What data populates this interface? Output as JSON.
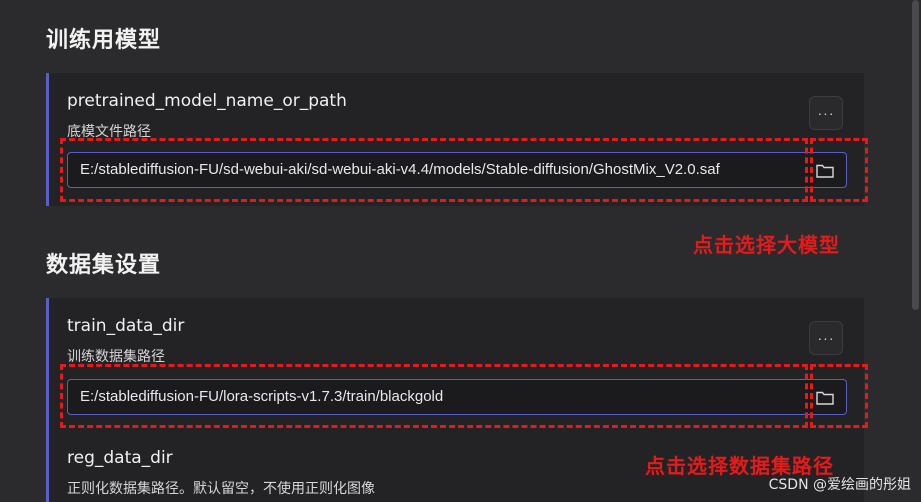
{
  "sections": {
    "training_model": {
      "title": "训练用模型",
      "field": {
        "name": "pretrained_model_name_or_path",
        "description": "底模文件路径",
        "value": "E:/stablediffusion-FU/sd-webui-aki/sd-webui-aki-v4.4/models/Stable-diffusion/GhostMix_V2.0.saf"
      }
    },
    "dataset": {
      "title": "数据集设置",
      "fields": [
        {
          "name": "train_data_dir",
          "description": "训练数据集路径",
          "value": "E:/stablediffusion-FU/lora-scripts-v1.7.3/train/blackgold"
        },
        {
          "name": "reg_data_dir",
          "description": "正则化数据集路径。默认留空，不使用正则化图像"
        }
      ]
    }
  },
  "buttons": {
    "more_label": "···"
  },
  "icons": {
    "folder": "folder-icon"
  },
  "annotations": {
    "select_model": "点击选择大模型",
    "select_dataset": "点击选择数据集路径"
  },
  "watermark": "CSDN @爱绘画的彤姐",
  "colors": {
    "accent": "#5a5fc8",
    "annotation_red": "#e51b1b",
    "background": "#2b2b2d"
  }
}
